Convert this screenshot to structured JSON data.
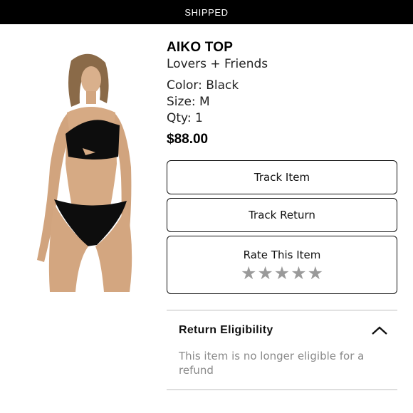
{
  "status": {
    "label": "SHIPPED"
  },
  "product": {
    "name": "AIKO TOP",
    "brand": "Lovers + Friends",
    "color": "Color: Black",
    "size": "Size: M",
    "qty": "Qty: 1",
    "price": "$88.00",
    "image_icon": "product-photo"
  },
  "actions": {
    "track_item": "Track Item",
    "track_return": "Track Return"
  },
  "rating": {
    "label": "Rate This Item",
    "stars": [
      "★",
      "★",
      "★",
      "★",
      "★"
    ],
    "star_color": "#9a9a9a"
  },
  "eligibility": {
    "title": "Return Eligibility",
    "text": "This item is no longer eligible for a refund",
    "expanded": true,
    "icon": "chevron-up-icon"
  }
}
